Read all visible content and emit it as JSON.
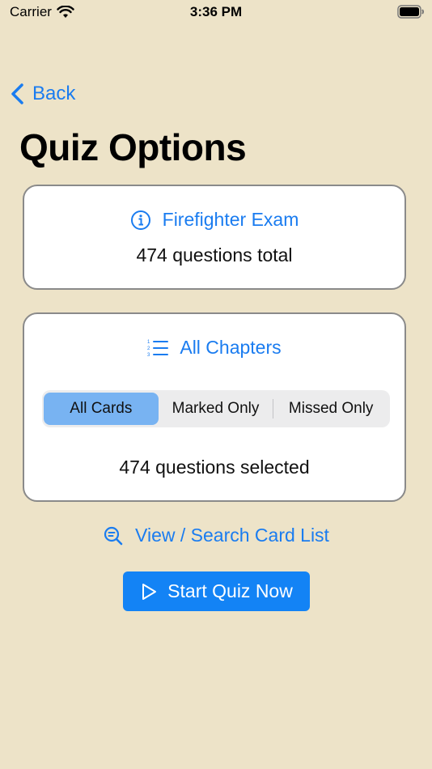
{
  "status_bar": {
    "carrier": "Carrier",
    "time": "3:36 PM"
  },
  "nav": {
    "back_label": "Back"
  },
  "page_title": "Quiz Options",
  "exam_card": {
    "heading": "Firefighter Exam",
    "icon": "info-icon",
    "summary": "474 questions total"
  },
  "chapters_card": {
    "heading": "All Chapters",
    "icon": "numbered-list-icon",
    "segments": [
      "All Cards",
      "Marked Only",
      "Missed Only"
    ],
    "selected_segment": "All Cards",
    "summary": "474 questions selected"
  },
  "search_link": {
    "label": "View / Search Card List",
    "icon": "search-list-icon"
  },
  "start_button": {
    "label": "Start Quiz Now",
    "icon": "play-icon"
  },
  "colors": {
    "background": "#ede3c8",
    "accent": "#1a7cf0",
    "selected_segment": "#78b3f2",
    "button": "#1383f5"
  }
}
